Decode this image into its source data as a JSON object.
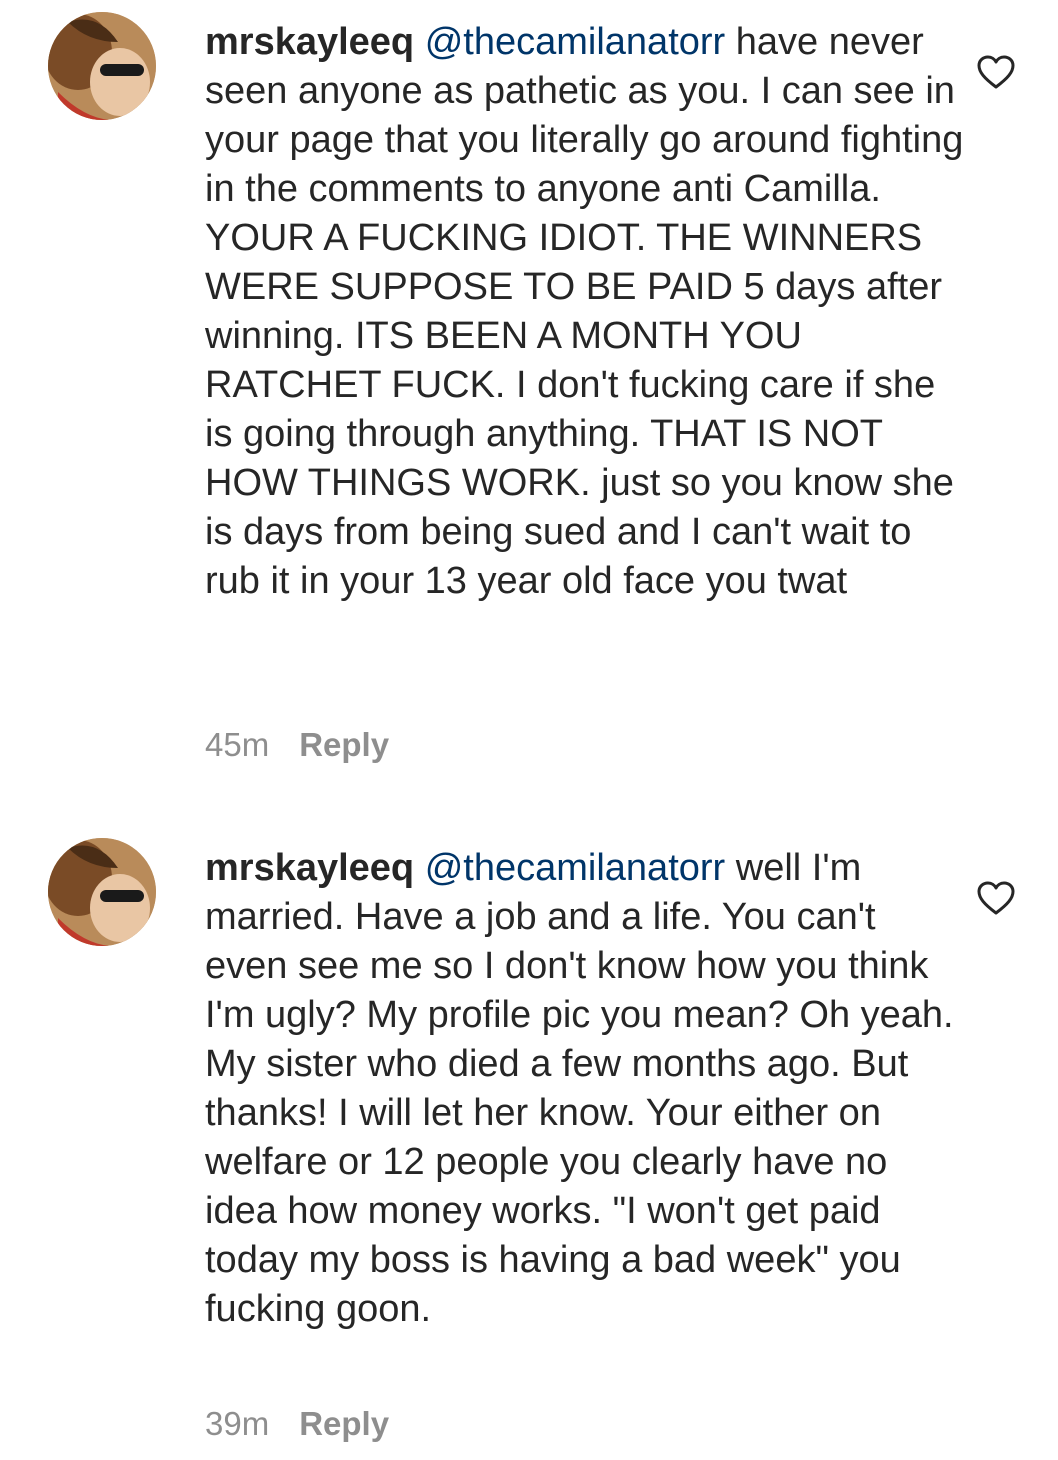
{
  "comments": [
    {
      "username": "mrskayleeq",
      "mention": "@thecamilanatorr",
      "text": "have never seen anyone as pathetic as you. I can see in your page that you literally go around fighting in the comments to anyone anti Camilla. YOUR A FUCKING IDIOT. THE WINNERS WERE SUPPOSE TO BE PAID 5 days after winning. ITS BEEN A MONTH YOU RATCHET FUCK. I don't fucking care if she is going through anything. THAT IS NOT HOW THINGS WORK. just so you know she is days from being sued and I can't wait to rub it in your 13 year old face you twat",
      "time": "45m",
      "reply_label": "Reply",
      "avatar_icon": "profile-photo",
      "like_icon": "heart-outline-icon"
    },
    {
      "username": "mrskayleeq",
      "mention": "@thecamilanatorr",
      "text": "well I'm married. Have a job and a life. You can't even see me so I don't know how you think I'm ugly? My profile pic you mean? Oh yeah. My sister who died a few months ago. But thanks! I will let her know. Your either on welfare or 12 people you clearly have no idea how money works. \"I won't get paid today my boss is having a bad week\" you fucking goon.",
      "time": "39m",
      "reply_label": "Reply",
      "avatar_icon": "profile-photo",
      "like_icon": "heart-outline-icon"
    }
  ],
  "colors": {
    "text": "#262626",
    "mention": "#003569",
    "meta": "#8e8e8e"
  }
}
